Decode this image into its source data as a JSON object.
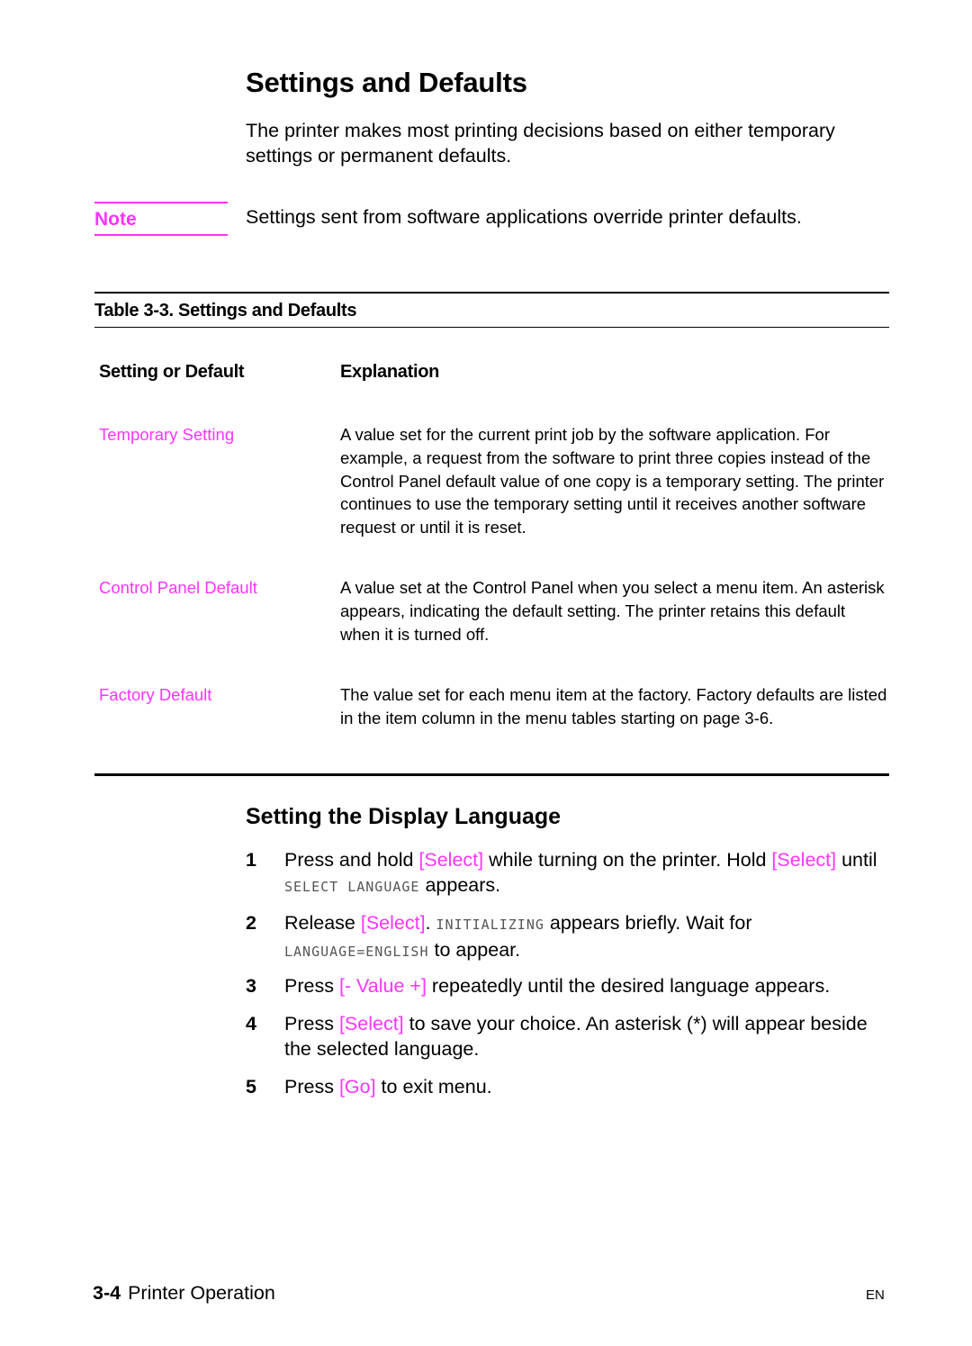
{
  "page": {
    "title": "Settings and Defaults",
    "intro": "The printer makes most printing decisions based on either temporary settings or permanent defaults.",
    "note": {
      "label": "Note",
      "text": "Settings sent from software applications override printer defaults."
    },
    "table": {
      "caption": "Table 3-3. Settings and Defaults",
      "columns": [
        "Setting or Default",
        "Explanation"
      ],
      "rows": [
        {
          "setting": "Temporary Setting",
          "explanation": "A value set for the current print job by the software application. For example, a request from the software to print three copies instead of the Control Panel default value of one copy is a temporary setting. The printer continues to use the temporary setting until it receives another software request or until it is reset."
        },
        {
          "setting": "Control Panel Default",
          "explanation": "A value set at the Control Panel when you select a menu item. An asterisk appears, indicating the default setting. The printer retains this default when it is turned off."
        },
        {
          "setting": "Factory Default",
          "explanation": "The value set for each menu item at the factory. Factory defaults are listed in the item column in the menu tables starting on page 3-6."
        }
      ]
    },
    "section": {
      "title": "Setting the Display Language",
      "steps": [
        {
          "num": "1",
          "parts": [
            {
              "t": "Press and hold ",
              "k": "text"
            },
            {
              "t": "[Select]",
              "k": "key"
            },
            {
              "t": " while turning on the printer. Hold ",
              "k": "text"
            },
            {
              "t": "[Select]",
              "k": "key"
            },
            {
              "t": " until ",
              "k": "text"
            },
            {
              "t": "SELECT LANGUAGE",
              "k": "lcd"
            },
            {
              "t": " appears.",
              "k": "text"
            }
          ]
        },
        {
          "num": "2",
          "parts": [
            {
              "t": "Release ",
              "k": "text"
            },
            {
              "t": "[Select]",
              "k": "key"
            },
            {
              "t": ". ",
              "k": "text"
            },
            {
              "t": "INITIALIZING",
              "k": "lcd"
            },
            {
              "t": " appears briefly. Wait for ",
              "k": "text"
            },
            {
              "t": "LANGUAGE=ENGLISH",
              "k": "lcd"
            },
            {
              "t": " to appear.",
              "k": "text"
            }
          ]
        },
        {
          "num": "3",
          "parts": [
            {
              "t": "Press ",
              "k": "text"
            },
            {
              "t": "[- Value +]",
              "k": "key"
            },
            {
              "t": " repeatedly until the desired language appears.",
              "k": "text"
            }
          ]
        },
        {
          "num": "4",
          "parts": [
            {
              "t": "Press ",
              "k": "text"
            },
            {
              "t": "[Select]",
              "k": "key"
            },
            {
              "t": " to save your choice. An asterisk (*) will appear beside the selected language.",
              "k": "text"
            }
          ]
        },
        {
          "num": "5",
          "parts": [
            {
              "t": "Press ",
              "k": "text"
            },
            {
              "t": "[Go]",
              "k": "key"
            },
            {
              "t": " to exit menu.",
              "k": "text"
            }
          ]
        }
      ]
    },
    "footer": {
      "page_number": "3-4",
      "chapter": "Printer Operation",
      "lang": "EN"
    },
    "colors": {
      "accent": "#ff33ff",
      "text": "#000000"
    }
  }
}
